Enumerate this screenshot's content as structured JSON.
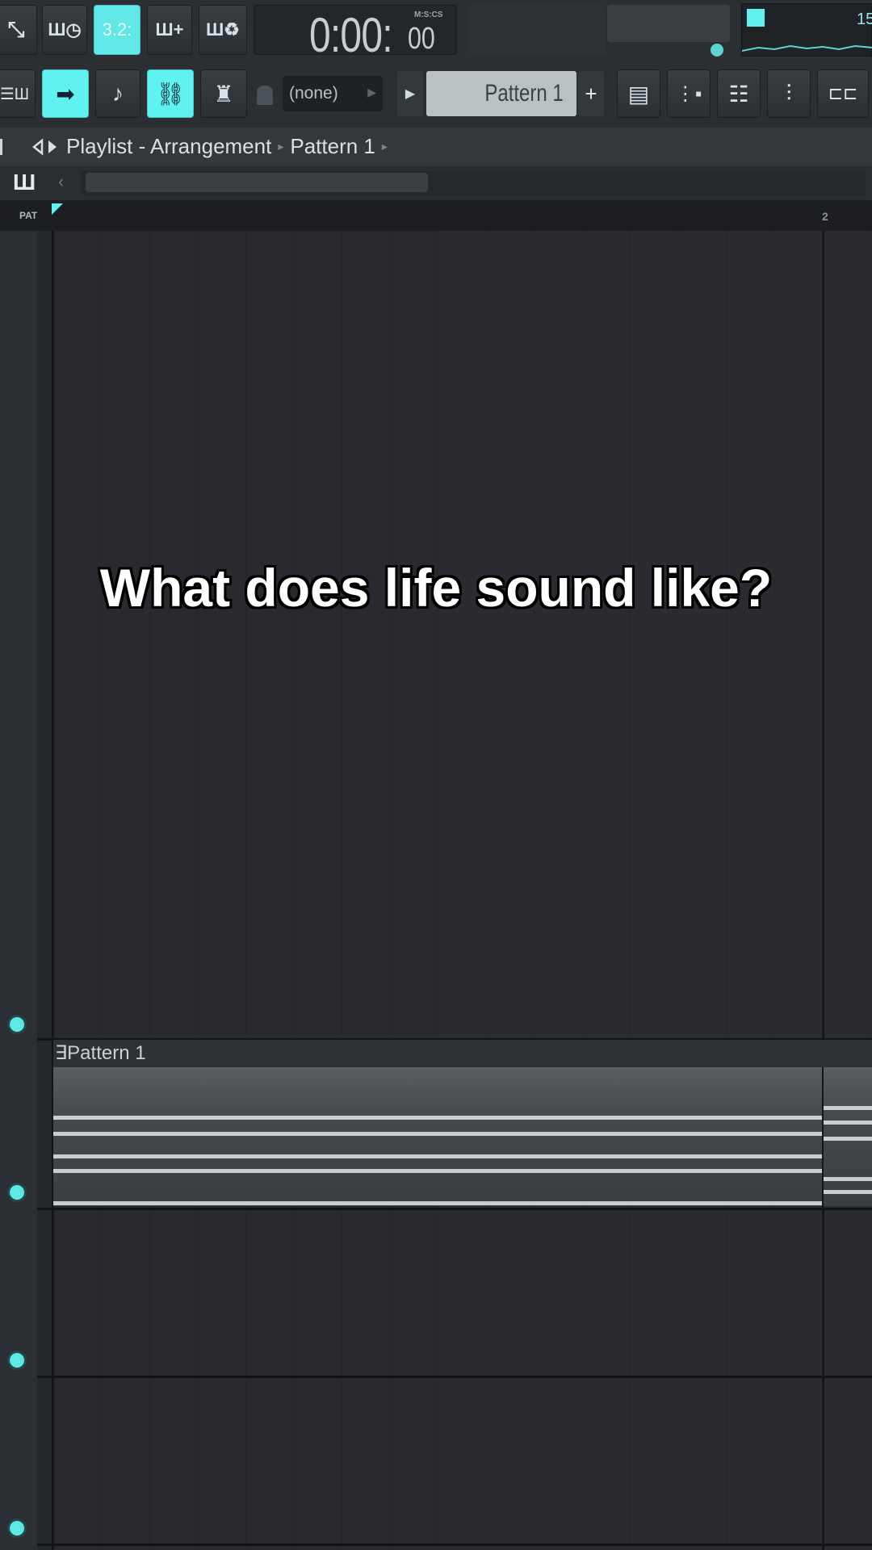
{
  "toolbar_row1": {
    "buttons": [
      {
        "name": "record-icon",
        "glyph": "⤡"
      },
      {
        "name": "metronome-icon",
        "glyph": "Ш◷"
      },
      {
        "name": "tempo-icon",
        "glyph": "3.2:"
      },
      {
        "name": "add-pattern-icon",
        "glyph": "Ш+"
      },
      {
        "name": "loop-icon",
        "glyph": "Ш♻"
      }
    ],
    "time": {
      "main": "0:00:",
      "cs": "00",
      "format": "M:S:CS"
    },
    "monitor_value": "15"
  },
  "toolbar_row2": {
    "buttons": [
      {
        "name": "piano-roll-icon",
        "glyph": "☰Ш"
      },
      {
        "name": "step-arrow-icon",
        "glyph": "➡"
      },
      {
        "name": "note-icon",
        "glyph": "♪"
      },
      {
        "name": "link-icon",
        "glyph": "⛓"
      },
      {
        "name": "stamp-icon",
        "glyph": "♜"
      }
    ],
    "snap_value": "(none)",
    "pattern_selector": "Pattern 1",
    "add_label": "+",
    "right_buttons": [
      {
        "name": "playlist-window-icon",
        "glyph": "▤"
      },
      {
        "name": "channel-rack-icon",
        "glyph": "⋮▪"
      },
      {
        "name": "browser-icon",
        "glyph": "☷"
      },
      {
        "name": "mixer-icon",
        "glyph": "⫶"
      },
      {
        "name": "plugin-picker-icon",
        "glyph": "⊏⊏"
      }
    ]
  },
  "titlebar": {
    "crumb1": "Playlist - Arrangement",
    "crumb2": "Pattern 1",
    "sep": "▸"
  },
  "ruler": {
    "pat_label": "PAT",
    "bar2": "2"
  },
  "clip": {
    "label": "Pattern 1",
    "icon": "∃"
  },
  "caption": "What does life sound like?",
  "colors": {
    "accent": "#5ff2ef",
    "background": "#2a2c31"
  }
}
